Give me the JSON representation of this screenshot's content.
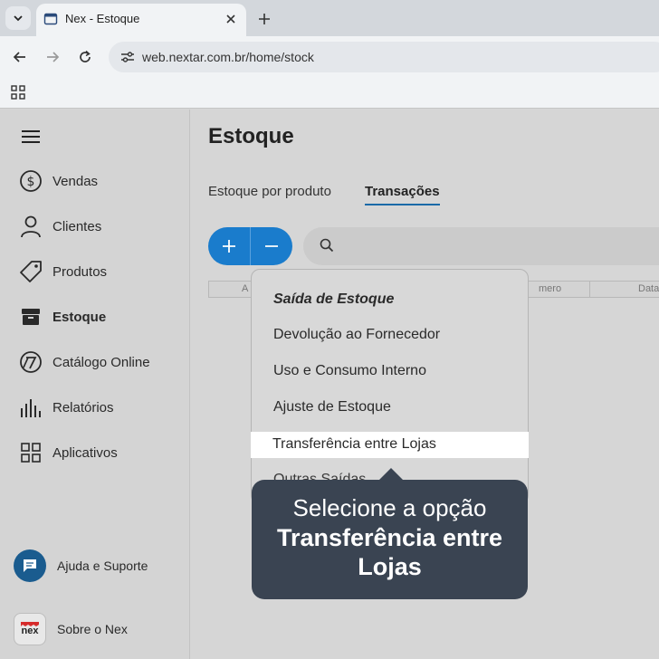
{
  "browser": {
    "tab_title": "Nex - Estoque",
    "url": "web.nextar.com.br/home/stock"
  },
  "sidebar": {
    "items": [
      {
        "label": "Vendas",
        "icon": "dollar-circle-icon"
      },
      {
        "label": "Clientes",
        "icon": "user-icon"
      },
      {
        "label": "Produtos",
        "icon": "tag-icon"
      },
      {
        "label": "Estoque",
        "icon": "box-icon",
        "active": true
      },
      {
        "label": "Catálogo Online",
        "icon": "catalog-icon"
      },
      {
        "label": "Relatórios",
        "icon": "bar-chart-icon"
      },
      {
        "label": "Aplicativos",
        "icon": "apps-grid-icon"
      }
    ],
    "help_label": "Ajuda e Suporte",
    "about_label": "Sobre o Nex",
    "logo_text": "nex"
  },
  "main": {
    "title": "Estoque",
    "tabs": [
      {
        "label": "Estoque por produto",
        "active": false
      },
      {
        "label": "Transações",
        "active": true
      }
    ],
    "table_headers": [
      "A",
      "mero",
      "Data"
    ]
  },
  "menu": {
    "header": "Saída de Estoque",
    "items": [
      "Devolução ao Fornecedor",
      "Uso e Consumo Interno",
      "Ajuste de Estoque",
      "Transferência entre Lojas",
      "Outras Saídas"
    ]
  },
  "callout": {
    "line1": "Selecione a opção",
    "line2": "Transferência entre Lojas"
  },
  "colors": {
    "accent": "#1a7ccc",
    "callout_bg": "#3a4452",
    "help_bg": "#1a5c8f"
  }
}
